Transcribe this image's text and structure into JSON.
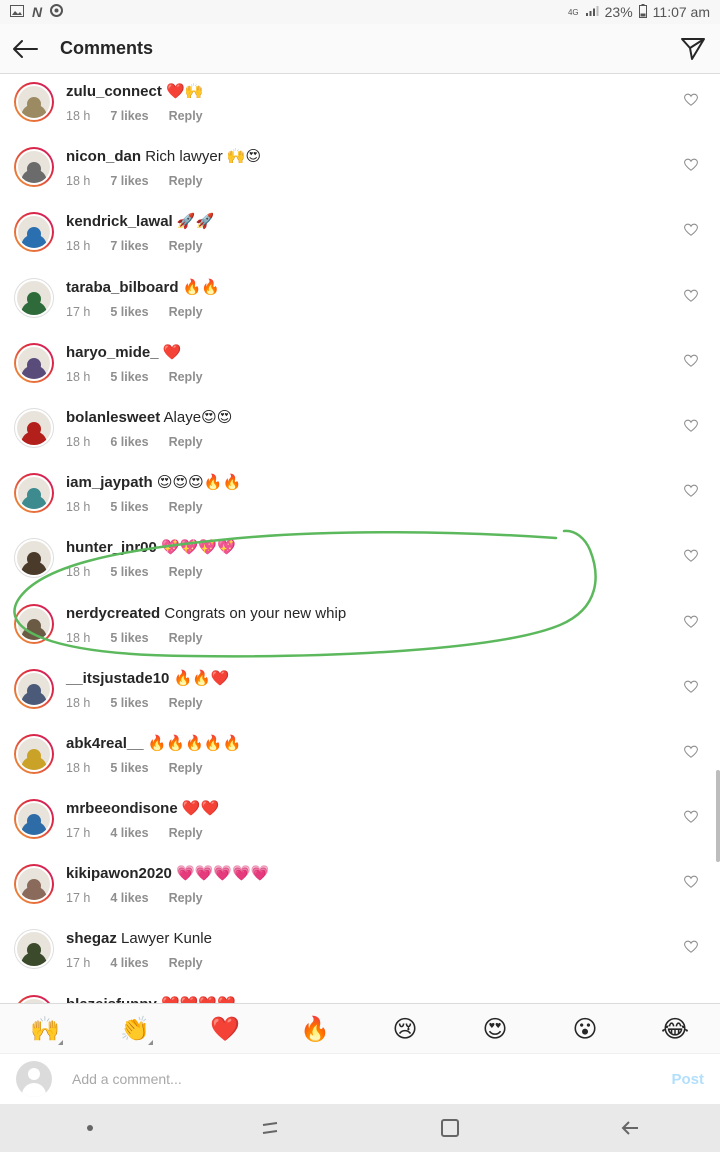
{
  "status_bar": {
    "network": "4G",
    "battery": "23%",
    "time": "11:07 am"
  },
  "header": {
    "title": "Comments"
  },
  "comments": [
    {
      "username": "zulu_connect",
      "text": "❤️🙌",
      "time": "18 h",
      "likes": "7 likes",
      "reply": "Reply",
      "ring": true,
      "color": "#9b8a62"
    },
    {
      "username": "nicon_dan",
      "text": "Rich lawyer 🙌😍",
      "time": "18 h",
      "likes": "7 likes",
      "reply": "Reply",
      "ring": true,
      "color": "#6b6b6b"
    },
    {
      "username": "kendrick_lawal",
      "text": "🚀🚀",
      "time": "18 h",
      "likes": "7 likes",
      "reply": "Reply",
      "ring": true,
      "color": "#2a6fb0"
    },
    {
      "username": "taraba_bilboard",
      "text": "🔥🔥",
      "time": "17 h",
      "likes": "5 likes",
      "reply": "Reply",
      "ring": false,
      "color": "#2f6b3a"
    },
    {
      "username": "haryo_mide_",
      "text": "❤️",
      "time": "18 h",
      "likes": "5 likes",
      "reply": "Reply",
      "ring": true,
      "color": "#5a4c7a"
    },
    {
      "username": "bolanlesweet",
      "text": "Alaye😍😍",
      "time": "18 h",
      "likes": "6 likes",
      "reply": "Reply",
      "ring": false,
      "color": "#b3201c"
    },
    {
      "username": "iam_jaypath",
      "text": "😍😍😍🔥🔥",
      "time": "18 h",
      "likes": "5 likes",
      "reply": "Reply",
      "ring": true,
      "color": "#3d8a8f"
    },
    {
      "username": "hunter_jnr00",
      "text": "💖💖💖💖",
      "time": "18 h",
      "likes": "5 likes",
      "reply": "Reply",
      "ring": false,
      "color": "#4a3a2a"
    },
    {
      "username": "nerdycreated",
      "text": "Congrats on your new whip",
      "time": "18 h",
      "likes": "5 likes",
      "reply": "Reply",
      "ring": true,
      "color": "#6b5b45"
    },
    {
      "username": "__itsjustade10",
      "text": "🔥🔥❤️",
      "time": "18 h",
      "likes": "5 likes",
      "reply": "Reply",
      "ring": true,
      "color": "#4a5a78"
    },
    {
      "username": "abk4real__",
      "text": "🔥🔥🔥🔥🔥",
      "time": "18 h",
      "likes": "5 likes",
      "reply": "Reply",
      "ring": true,
      "color": "#c9a227"
    },
    {
      "username": "mrbeeondisone",
      "text": "❤️❤️",
      "time": "17 h",
      "likes": "4 likes",
      "reply": "Reply",
      "ring": true,
      "color": "#2e6ca8"
    },
    {
      "username": "kikipawon2020",
      "text": "💗💗💗💗💗",
      "time": "17 h",
      "likes": "4 likes",
      "reply": "Reply",
      "ring": true,
      "color": "#8a6a5a"
    },
    {
      "username": "shegaz",
      "text": "Lawyer Kunle",
      "time": "17 h",
      "likes": "4 likes",
      "reply": "Reply",
      "ring": false,
      "color": "#3a4a2a"
    },
    {
      "username": "blazeisfunny",
      "text": "❤️❤️❤️❤️",
      "time": "",
      "likes": "",
      "reply": "",
      "ring": true,
      "color": "#7a5a4a"
    }
  ],
  "reactions": [
    "🙌",
    "👏",
    "❤️",
    "🔥",
    "😢",
    "😍",
    "😮",
    "😂"
  ],
  "composer": {
    "placeholder": "Add a comment...",
    "post_label": "Post"
  },
  "icons": {
    "back": "back-arrow-icon",
    "direct": "paper-plane-icon",
    "like": "heart-outline-icon"
  },
  "colors": {
    "highlight_stroke": "#5cb85c",
    "post_disabled": "#b2dffc",
    "meta_gray": "#8e8e8e"
  }
}
